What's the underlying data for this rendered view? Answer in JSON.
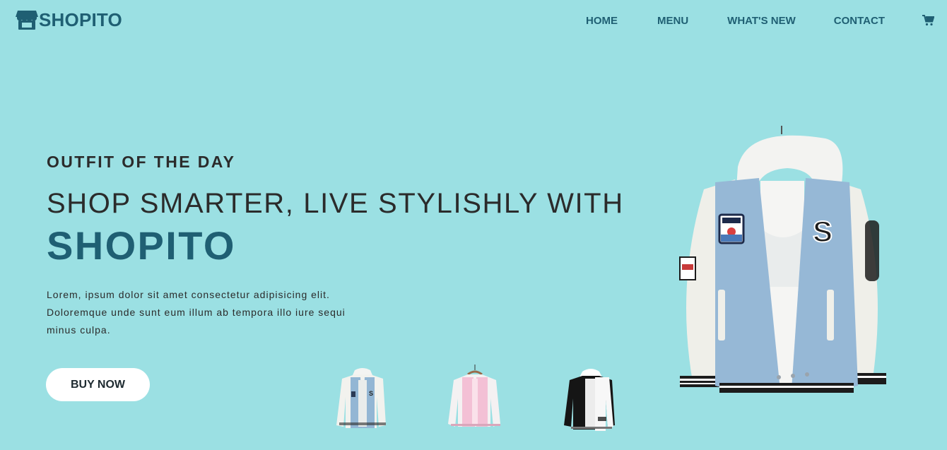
{
  "nav": {
    "logo_text": "SHOPITO",
    "links": [
      "HOME",
      "MENU",
      "WHAT'S NEW",
      "CONTACT"
    ],
    "cart_icon": "cart-icon",
    "logo_icon": "store-icon"
  },
  "hero": {
    "eyebrow": "OUTFIT OF THE DAY",
    "headline": "SHOP SMARTER, LIVE STYLISHLY WITH",
    "brand": "SHOPITO",
    "description": "Lorem, ipsum dolor sit amet consectetur adipisicing elit. Doloremque unde sunt eum illum ab tempora illo iure sequi minus culpa.",
    "cta_label": "BUY NOW"
  },
  "thumbnails": [
    {
      "name": "blue-varsity-jacket",
      "color": "#8fb3d3"
    },
    {
      "name": "pink-varsity-jacket",
      "color": "#f3c1d6"
    },
    {
      "name": "black-white-varsity-jacket",
      "color": "#1d1d1d"
    }
  ],
  "colors": {
    "background": "#9be0e3",
    "brand": "#1f5f73",
    "text": "#2b2b2b",
    "button_bg": "#ffffff"
  }
}
